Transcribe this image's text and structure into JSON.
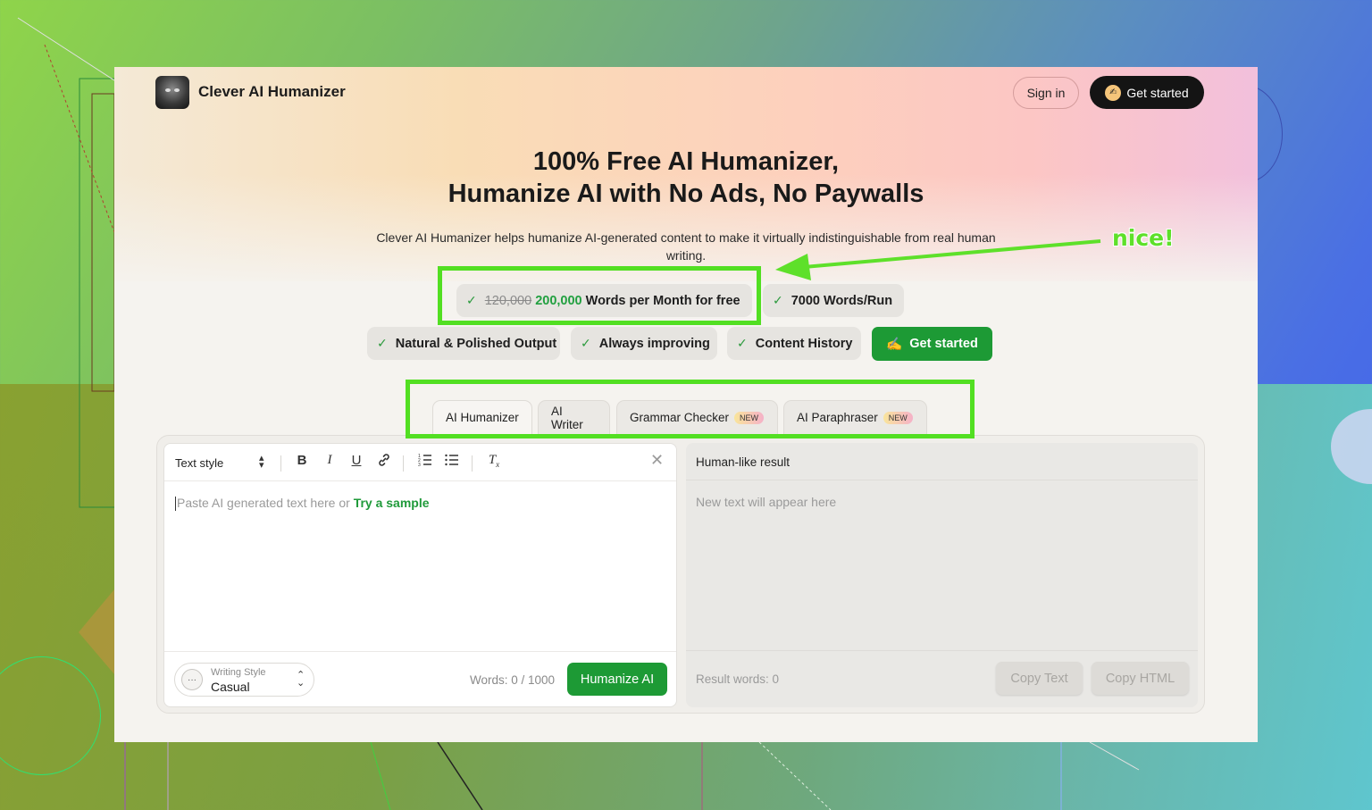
{
  "app": {
    "brand": "Clever AI Humanizer",
    "sign_in": "Sign in",
    "get_started": "Get started"
  },
  "hero": {
    "title_line1": "100% Free AI Humanizer,",
    "title_line2": "Humanize AI with No Ads, No Paywalls",
    "subtitle": "Clever AI Humanizer helps humanize AI-generated content to make it virtually indistinguishable from real human writing."
  },
  "features": {
    "words_old": "120,000",
    "words_new": "200,000",
    "words_suffix": "Words per Month for free",
    "words_per_run": "7000 Words/Run",
    "natural": "Natural & Polished Output",
    "improving": "Always improving",
    "history": "Content History",
    "cta": "Get started",
    "cta_emoji": "✍️"
  },
  "tabs": [
    {
      "label": "AI Humanizer",
      "active": true
    },
    {
      "label": "AI Writer"
    },
    {
      "label": "Grammar Checker",
      "badge": "NEW"
    },
    {
      "label": "AI Paraphraser",
      "badge": "NEW"
    }
  ],
  "editor": {
    "text_style": "Text style",
    "placeholder_prefix": "Paste AI generated text here or",
    "try_sample": "Try a sample",
    "writing_style_label": "Writing Style",
    "writing_style_value": "Casual",
    "word_count": "Words: 0 / 1000",
    "humanize_button": "Humanize AI"
  },
  "result": {
    "title": "Human-like result",
    "placeholder": "New text will appear here",
    "result_words": "Result words: 0",
    "copy_text": "Copy Text",
    "copy_html": "Copy HTML"
  },
  "annotation": {
    "note": "nice!",
    "highlight_color": "#52df22"
  },
  "colors": {
    "accent_green": "#1d9a35",
    "dark_button": "#141414"
  }
}
